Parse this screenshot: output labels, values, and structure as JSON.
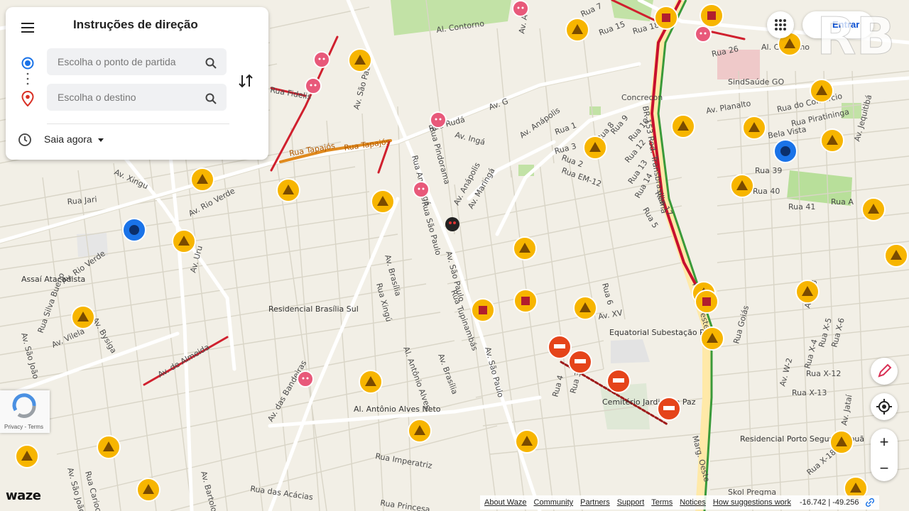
{
  "panel": {
    "title": "Instruções de direção",
    "origin_placeholder": "Escolha o ponto de partida",
    "destination_placeholder": "Escolha o destino",
    "depart_label": "Saia agora"
  },
  "header": {
    "login_label": "Entrar",
    "watermark": "RB"
  },
  "map": {
    "street_labels": [
      "Al. Contorno",
      "Rua 7",
      "Rua 15",
      "Rua 18",
      "Rua 26",
      "Al. Contorno",
      "Av. A",
      "Av. São Paulo",
      "Av. G",
      "Rua Tapajós",
      "Rua Tapajós",
      "Rua Fidelis",
      "Av. Rio Verde",
      "Rua Rudá",
      "Av. Ingá",
      "Av. Anápolis",
      "Rua Pindorama",
      "Rua Anhangá",
      "Rua São Paulo",
      "Av. Maringá",
      "Av. Anápolis",
      "Rua 1",
      "Rua 2",
      "Rua 3",
      "Rua EM-12",
      "Rua 8",
      "Rua 9",
      "Rua 10",
      "Rua 12",
      "Rua 13",
      "Rua 14",
      "Rua 17",
      "Rua 5",
      "Concrecon",
      "SindSaúde GO",
      "Rua do Comercio",
      "Av. Planalto",
      "Rua Piratininga",
      "Bela Vista",
      "Rua 39",
      "Rua 40",
      "Rua 41",
      "Rua A",
      "Av. Jequitibá",
      "Av. Xingu",
      "Rua Jari",
      "Av. Rio Verde",
      "Av. Uru",
      "Assaí Atacadista",
      "Rua Silva Bueno",
      "Av. Vilela",
      "Av. São João",
      "Av. Bysiga",
      "Av. Brasília",
      "Rua Xingú",
      "Residencial Brasília Sul",
      "Av. São Paulo",
      "Rua Tupinambás",
      "Av. São Paulo",
      "Rua 6",
      "Av. XV",
      "Equatorial Subestação Real",
      "Rua 4",
      "Rua 3",
      "Cemitério Jardim da Paz",
      "Av. de Almeida",
      "Av. das Bandeiras",
      "Al. Antônio Alves",
      "Al. Antônio Alves Neto",
      "Av. Brasília",
      "Rua Goiás",
      "Av. W-2",
      "Av. W-3",
      "Rua X-4",
      "Rua X-5",
      "Rua X-6",
      "Rua X-12",
      "Rua X-13",
      "Av. Jataí",
      "Residencial Porto Seguro Itapuã",
      "Rua X-18",
      "Rua Imperatriz",
      "Rua das Acácias",
      "Rua Carioca",
      "Av. São João",
      "Av. Bartolomeu",
      "Rua Princesa",
      "Skol Pregma",
      "Marg. Oeste",
      "Marg. Oeste",
      "BR-153 Rod. Transbrasiliana"
    ]
  },
  "recaptcha": {
    "text": "Privacy - Terms"
  },
  "logo": {
    "text": "waze"
  },
  "footer": {
    "links": [
      "About Waze",
      "Community",
      "Partners",
      "Support",
      "Terms",
      "Notices",
      "How suggestions work"
    ],
    "coords": "-16.742 | -49.256"
  },
  "colors": {
    "jam_red": "#d0202e",
    "jam_orange": "#e08a1e",
    "highway_green": "#3a9a3a",
    "alert_yellow": "#f7b500",
    "police_blue": "#1a73e8",
    "map_bg": "#f2efe6",
    "park_green": "#b8df9a"
  },
  "icons": [
    "menu-icon",
    "origin-icon",
    "destination-pin-icon",
    "search-icon",
    "swap-icon",
    "clock-icon",
    "apps-grid-icon",
    "edit-icon",
    "locate-icon",
    "zoom-in-icon",
    "zoom-out-icon",
    "link-icon",
    "hazard-icon",
    "police-icon",
    "jam-icon",
    "closure-icon",
    "crash-icon"
  ],
  "zoom": {
    "in_label": "+",
    "out_label": "−"
  }
}
